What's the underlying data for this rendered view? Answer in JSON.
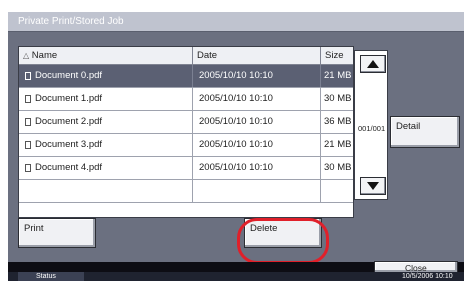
{
  "window": {
    "title": "Private Print/Stored Job"
  },
  "table": {
    "columns": [
      "Name",
      "Date",
      "Size"
    ],
    "sort_icon": "triangle-up-icon",
    "rows": [
      {
        "name": "Document 0.pdf",
        "date": "2005/10/10 10:10",
        "size": "21 MB",
        "selected": true
      },
      {
        "name": "Document 1.pdf",
        "date": "2005/10/10 10:10",
        "size": "30 MB",
        "selected": false
      },
      {
        "name": "Document 2.pdf",
        "date": "2005/10/10 10:10",
        "size": "36 MB",
        "selected": false
      },
      {
        "name": "Document 3.pdf",
        "date": "2005/10/10 10:10",
        "size": "21 MB",
        "selected": false
      },
      {
        "name": "Document 4.pdf",
        "date": "2005/10/10 10:10",
        "size": "30 MB",
        "selected": false
      }
    ]
  },
  "pagination": {
    "indicator": "001/001"
  },
  "buttons": {
    "detail": "Detail",
    "print": "Print",
    "delete": "Delete",
    "close": "Close"
  },
  "status": {
    "label": "Status",
    "datetime": "10/5/2006  10:10"
  },
  "highlight_color": "#e0202a"
}
